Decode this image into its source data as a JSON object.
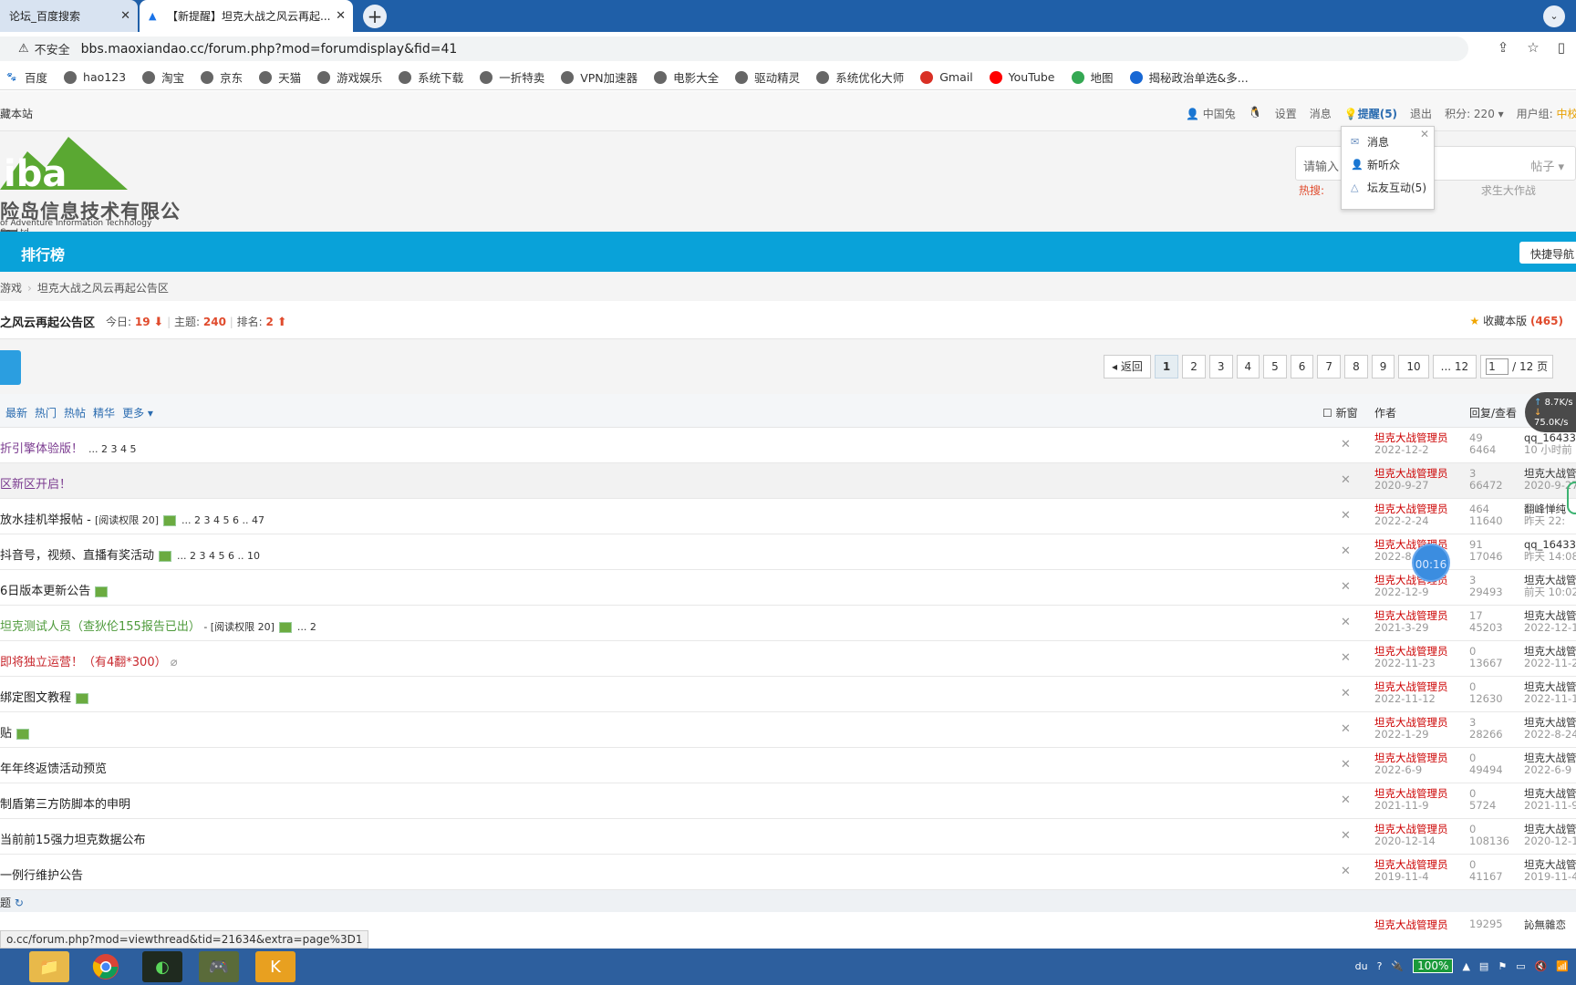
{
  "browser": {
    "tabs": [
      {
        "label": "论坛_百度搜索"
      },
      {
        "label": "【新提醒】坦克大战之风云再起..."
      }
    ],
    "address": {
      "security": "不安全",
      "url": "bbs.maoxiandao.cc/forum.php?mod=forumdisplay&fid=41"
    },
    "bookmarks": [
      "百度",
      "hao123",
      "淘宝",
      "京东",
      "天猫",
      "游戏娱乐",
      "系统下载",
      "一折特卖",
      "VPN加速器",
      "电影大全",
      "驱动精灵",
      "系统优化大师",
      "Gmail",
      "YouTube",
      "地图",
      "揭秘政治单选&多..."
    ]
  },
  "topbar": {
    "left": "藏本站",
    "links": [
      "中国兔",
      "设置",
      "消息"
    ],
    "remind": "提醒(5)",
    "logout": "退出",
    "points": "积分: 220",
    "group_prefix": "用户组:",
    "group": "中校"
  },
  "header": {
    "logo_text": "iba",
    "company": "险岛信息技术有限公司",
    "company_en": "of Adventure Information Technology Co.,Ltd",
    "search_placeholder": "请输入",
    "search_type": "帖子",
    "hot_label": "热搜:",
    "hot_item": "求生大作战"
  },
  "notify_popup": {
    "items": [
      "消息",
      "新听众",
      "坛友互动(5)"
    ]
  },
  "nav": {
    "title": "排行榜",
    "quick": "快捷导航"
  },
  "breadcrumb": [
    "游戏",
    "坦克大战之风云再起公告区"
  ],
  "forum": {
    "name": "之风云再起公告区",
    "today_label": "今日:",
    "today": "19",
    "topics_label": "主题:",
    "topics": "240",
    "rank_label": "排名:",
    "rank": "2",
    "fav_label": "收藏本版",
    "fav_count": "(465)"
  },
  "pager": {
    "back": "返回",
    "pages": [
      "1",
      "2",
      "3",
      "4",
      "5",
      "6",
      "7",
      "8",
      "9",
      "10",
      "... 12"
    ],
    "input": "1",
    "total": "/ 12 页"
  },
  "net_widget": {
    "up": "8.7K/s",
    "down": "75.0K/s"
  },
  "filter": {
    "tabs": [
      "最新",
      "热门",
      "热帖",
      "精华",
      "更多"
    ],
    "new_window": "新窗",
    "author_col": "作者",
    "reply_col": "回复/查看"
  },
  "threads": [
    {
      "title": "折引擎体验版！",
      "color": "purple",
      "extra": "",
      "pages": "... 2 3 4 5",
      "author": "坦克大战管理员",
      "date": "2022-12-2",
      "replies": "49",
      "views": "6464",
      "last_user": "qq_16433",
      "last_time": "10 小时前"
    },
    {
      "title": "区新区开启！",
      "color": "purple",
      "extra": "",
      "pages": "",
      "author": "坦克大战管理员",
      "date": "2020-9-27",
      "replies": "3",
      "views": "66472",
      "last_user": "坦克大战管",
      "last_time": "2020-9-27"
    },
    {
      "title": "放水挂机举报帖 - ",
      "color": "black",
      "extra": "[阅读权限 20]",
      "pages": "... 2 3 4 5 6 .. 47",
      "author": "坦克大战管理员",
      "date": "2022-2-24",
      "replies": "464",
      "views": "11640",
      "last_user": "翻峰惮纯",
      "last_time": "昨天 22:"
    },
    {
      "title": "抖音号，视频、直播有奖活动",
      "color": "black",
      "extra": "",
      "pages": "... 2 3 4 5 6 .. 10",
      "author": "坦克大战管理员",
      "date": "2022-8",
      "replies": "91",
      "views": "17046",
      "last_user": "qq_16433",
      "last_time": "昨天 14:08"
    },
    {
      "title": "6日版本更新公告",
      "color": "black",
      "extra": "",
      "pages": "",
      "author": "坦克大战管理员",
      "date": "2022-12-9",
      "replies": "3",
      "views": "29493",
      "last_user": "坦克大战管",
      "last_time": "前天 10:02"
    },
    {
      "title": "坦克测试人员（查狄伦155报告已出）",
      "color": "green",
      "extra": " - [阅读权限 20]",
      "pages": "... 2",
      "author": "坦克大战管理员",
      "date": "2021-3-29",
      "replies": "17",
      "views": "45203",
      "last_user": "坦克大战管",
      "last_time": "2022-12-1"
    },
    {
      "title": "即将独立运营！（有4翻*300）",
      "color": "red",
      "extra": "",
      "pages": "",
      "author": "坦克大战管理员",
      "date": "2022-11-23",
      "replies": "0",
      "views": "13667",
      "last_user": "坦克大战管",
      "last_time": "2022-11-23"
    },
    {
      "title": "绑定图文教程",
      "color": "black",
      "extra": "",
      "pages": "",
      "author": "坦克大战管理员",
      "date": "2022-11-12",
      "replies": "0",
      "views": "12630",
      "last_user": "坦克大战管",
      "last_time": "2022-11-12"
    },
    {
      "title": "贴",
      "color": "black",
      "extra": "",
      "pages": "",
      "author": "坦克大战管理员",
      "date": "2022-1-29",
      "replies": "3",
      "views": "28266",
      "last_user": "坦克大战管",
      "last_time": "2022-8-24"
    },
    {
      "title": "年年终返馈活动预览",
      "color": "black",
      "extra": "",
      "pages": "",
      "author": "坦克大战管理员",
      "date": "2022-6-9",
      "replies": "0",
      "views": "49494",
      "last_user": "坦克大战管",
      "last_time": "2022-6-9 1"
    },
    {
      "title": "制盾第三方防脚本的申明",
      "color": "black",
      "extra": "",
      "pages": "",
      "author": "坦克大战管理员",
      "date": "2021-11-9",
      "replies": "0",
      "views": "5724",
      "last_user": "坦克大战管",
      "last_time": "2021-11-9"
    },
    {
      "title": "当前前15强力坦克数据公布",
      "color": "black",
      "extra": "",
      "pages": "",
      "author": "坦克大战管理员",
      "date": "2020-12-14",
      "replies": "0",
      "views": "108136",
      "last_user": "坦克大战管",
      "last_time": "2020-12-1"
    },
    {
      "title": "一例行维护公告",
      "color": "black",
      "extra": "",
      "pages": "",
      "author": "坦克大战管理员",
      "date": "2019-11-4",
      "replies": "0",
      "views": "41167",
      "last_user": "坦克大战管",
      "last_time": "2019-11-4"
    }
  ],
  "section": "题",
  "last_row": {
    "author": "坦克大战管理员",
    "replies": "19295",
    "last_user": "訫無雜恋"
  },
  "status_url": "o.cc/forum.php?mod=viewthread&tid=21634&extra=page%3D1",
  "timer": "00:16",
  "tray": {
    "ime": "du",
    "battery": "100%"
  }
}
